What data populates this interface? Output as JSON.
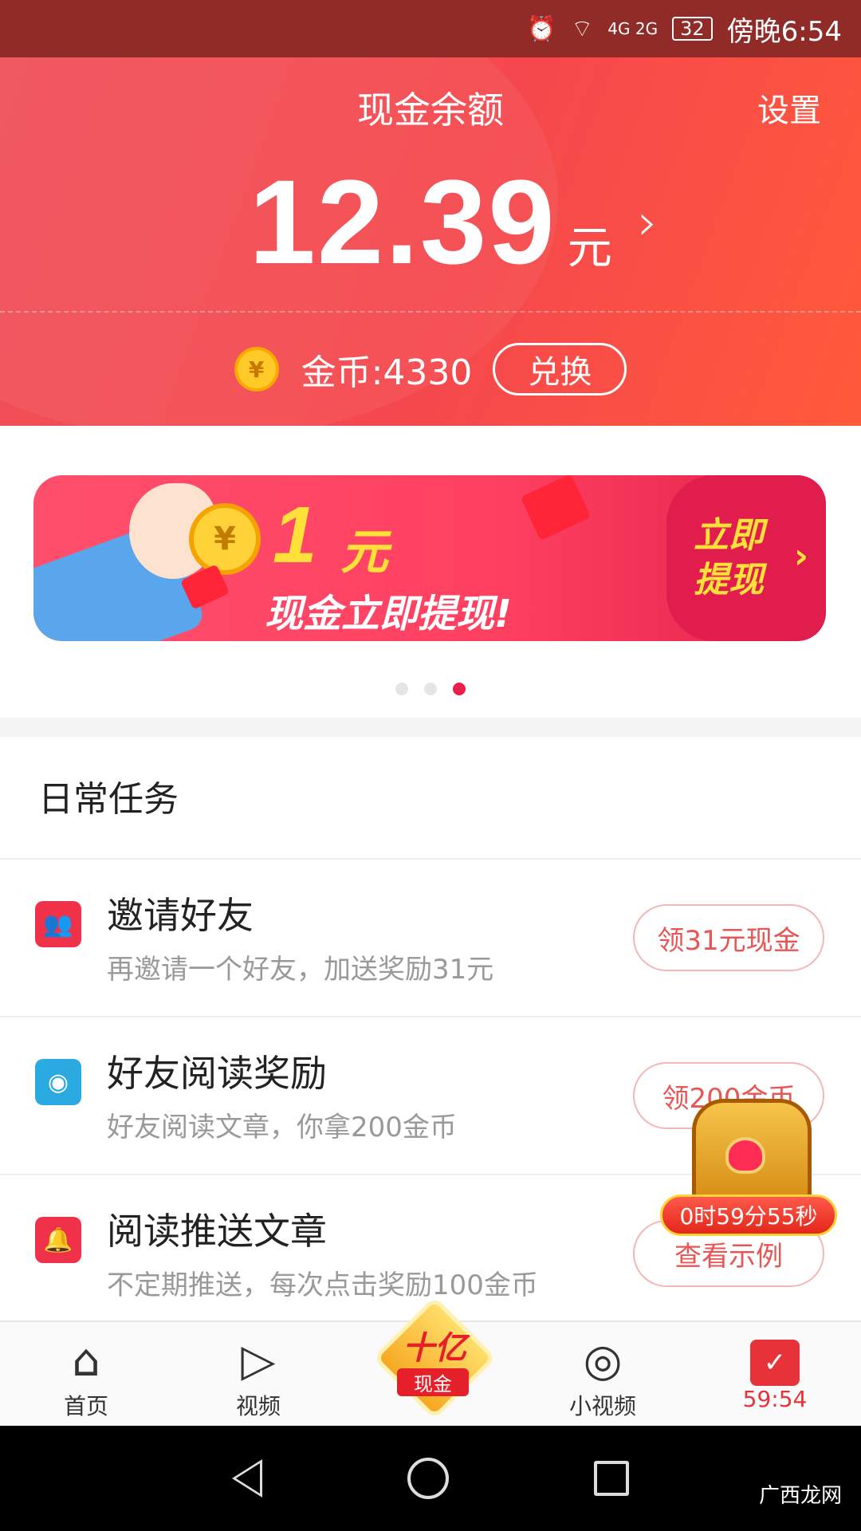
{
  "status_bar": {
    "network": "4G 2G",
    "battery": "32",
    "time": "傍晚6:54"
  },
  "header": {
    "title": "现金余额",
    "settings": "设置",
    "balance": "12.39",
    "unit": "元",
    "coins_label": "金币:4330",
    "exchange_label": "兑换"
  },
  "banner": {
    "amount": "1",
    "unit": "元",
    "subtitle": "现金立即提现!",
    "cta": "立即提现",
    "coin_symbol": "¥"
  },
  "tasks": {
    "title": "日常任务",
    "items": [
      {
        "name": "邀请好友",
        "desc": "再邀请一个好友，加送奖励31元",
        "button": "领31元现金",
        "icon": "group-icon",
        "color": "#f0314a"
      },
      {
        "name": "好友阅读奖励",
        "desc": "好友阅读文章，你拿200金币",
        "button": "领200金币",
        "icon": "eye-icon",
        "color": "#2aaae0"
      },
      {
        "name": "阅读推送文章",
        "desc": "不定期推送，每次点击奖励100金币",
        "button": "查看示例",
        "icon": "bell-icon",
        "color": "#f0314a"
      }
    ]
  },
  "treasure": {
    "timer": "0时59分55秒"
  },
  "tabbar": {
    "home": "首页",
    "video": "视频",
    "center_title": "十亿",
    "center_sub": "现金",
    "short_video": "小视频",
    "tasks_timer": "59:54"
  },
  "watermark": "广西龙网",
  "colors": {
    "accent": "#f0505a",
    "active_tab": "#e8323a"
  }
}
